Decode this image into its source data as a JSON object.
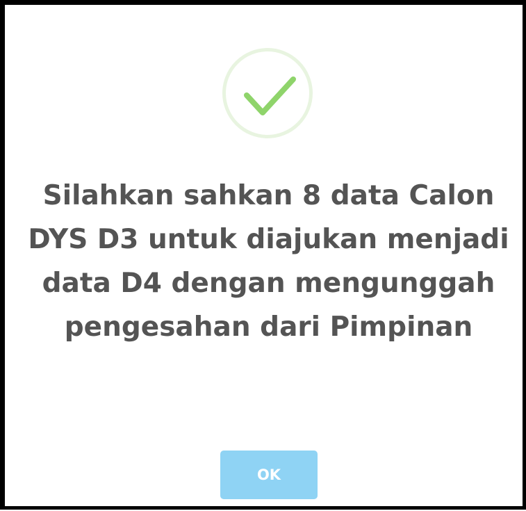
{
  "dialog": {
    "icon": "success-check-icon",
    "message": "Silahkan sahkan 8 data Calon DYS D3 untuk diajukan menjadi data D4 dengan mengunggah pengesahan dari Pimpinan",
    "ok_label": "OK"
  },
  "colors": {
    "check": "#8fd46b",
    "check_ring": "#e8f4e0",
    "ok_button": "#8fd3f4",
    "message_text": "#545454"
  }
}
